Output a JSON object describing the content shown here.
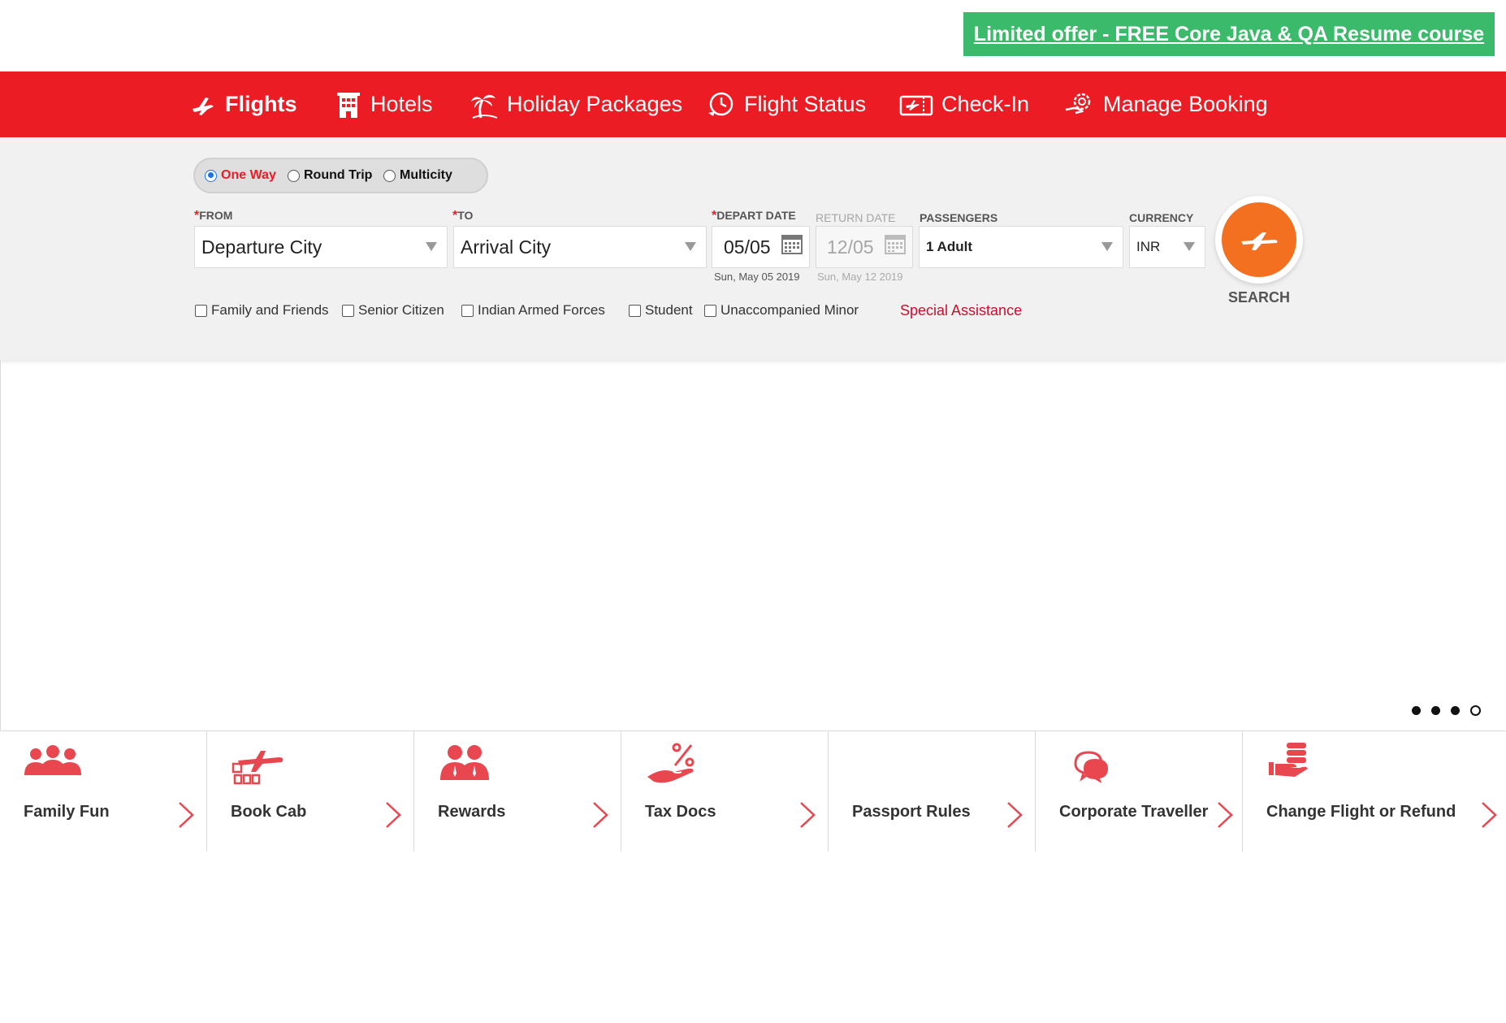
{
  "promo": {
    "text": "Limited offer - FREE Core Java & QA Resume course"
  },
  "nav": {
    "items": [
      {
        "label": "Flights",
        "icon": "plane-icon"
      },
      {
        "label": "Hotels",
        "icon": "hotel-icon"
      },
      {
        "label": "Holiday Packages",
        "icon": "palm-tree-icon"
      },
      {
        "label": "Flight Status",
        "icon": "clock-plane-icon"
      },
      {
        "label": "Check-In",
        "icon": "boarding-pass-icon"
      },
      {
        "label": "Manage Booking",
        "icon": "gear-hand-icon"
      }
    ],
    "active": "Flights"
  },
  "trip_type": {
    "options": [
      "One Way",
      "Round Trip",
      "Multicity"
    ],
    "selected": "One Way"
  },
  "form": {
    "from": {
      "label": "FROM",
      "value": "Departure City"
    },
    "to": {
      "label": "TO",
      "value": "Arrival City"
    },
    "depart": {
      "label": "DEPART DATE",
      "value": "05/05",
      "full": "Sun, May 05 2019"
    },
    "return": {
      "label": "RETURN DATE",
      "value": "12/05",
      "full": "Sun, May 12 2019"
    },
    "passengers": {
      "label": "PASSENGERS",
      "value": "1 Adult"
    },
    "currency": {
      "label": "CURRENCY",
      "value": "INR"
    },
    "required_mark": "*"
  },
  "concessions": [
    "Family and Friends",
    "Senior Citizen",
    "Indian Armed Forces",
    "Student",
    "Unaccompanied Minor"
  ],
  "special_assistance": "Special Assistance",
  "search": {
    "label": "SEARCH"
  },
  "carousel": {
    "slides": 4,
    "active_slide": 4
  },
  "quick_links": [
    {
      "label": "Family Fun",
      "icon": "family-icon"
    },
    {
      "label": "Book Cab",
      "icon": "plane-cab-icon"
    },
    {
      "label": "Rewards",
      "icon": "rewards-people-icon"
    },
    {
      "label": "Tax Docs",
      "icon": "percent-hand-icon"
    },
    {
      "label": "Passport Rules",
      "icon": ""
    },
    {
      "label": "Corporate Traveller",
      "icon": "chat-bubbles-icon"
    },
    {
      "label": "Change Flight or Refund",
      "icon": "refund-hand-icon"
    }
  ],
  "colors": {
    "brand_red": "#ec1c24",
    "promo_green": "#3cba6b",
    "search_orange": "#f37021",
    "special_red": "#c8102e"
  }
}
